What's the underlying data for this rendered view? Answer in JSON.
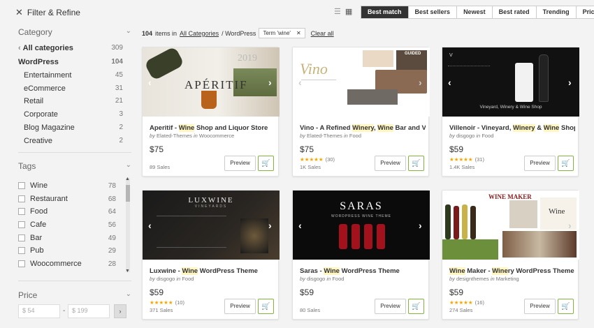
{
  "sidebar": {
    "filter_title": "Filter & Refine",
    "category_title": "Category",
    "all_categories": {
      "label": "All categories",
      "count": "309"
    },
    "categories": [
      {
        "label": "WordPress",
        "count": "104"
      },
      {
        "label": "Entertainment",
        "count": "45"
      },
      {
        "label": "eCommerce",
        "count": "31"
      },
      {
        "label": "Retail",
        "count": "21"
      },
      {
        "label": "Corporate",
        "count": "3"
      },
      {
        "label": "Blog Magazine",
        "count": "2"
      },
      {
        "label": "Creative",
        "count": "2"
      }
    ],
    "tags_title": "Tags",
    "tags": [
      {
        "label": "Wine",
        "count": "78"
      },
      {
        "label": "Restaurant",
        "count": "68"
      },
      {
        "label": "Food",
        "count": "64"
      },
      {
        "label": "Cafe",
        "count": "56"
      },
      {
        "label": "Bar",
        "count": "49"
      },
      {
        "label": "Pub",
        "count": "29"
      },
      {
        "label": "Woocommerce",
        "count": "28"
      }
    ],
    "price_title": "Price",
    "price_min_placeholder": "$ 54",
    "price_max_placeholder": "$ 199"
  },
  "toolbar": {
    "sort_options": [
      "Best match",
      "Best sellers",
      "Newest",
      "Best rated",
      "Trending",
      "Price"
    ],
    "active_sort": "Best match"
  },
  "results": {
    "count": "104",
    "items_in": "items in",
    "crumb_all": "All Categories",
    "crumb_sep": "/ WordPress",
    "term": "Term 'wine'",
    "clear": "Clear all"
  },
  "cards": [
    {
      "pre": "Aperitif - ",
      "hl1": "Wine",
      "mid": " Shop and Liquor Store",
      "hl2": "",
      "post": "",
      "by": "by",
      "author": "Elated-Themes",
      "in": "in",
      "cat": "Woocommerce",
      "price": "$75",
      "stars": "",
      "rating": "",
      "sales": "89 Sales",
      "thumb_text": "APÉRITIF",
      "thumb_sub": "2019"
    },
    {
      "pre": "Vino - A Refined ",
      "hl1": "Winery",
      "mid": ", ",
      "hl2": "Wine",
      "post": " Bar and Vin...",
      "by": "by",
      "author": "Elated-Themes",
      "in": "in",
      "cat": "Food",
      "price": "$75",
      "stars": "★★★★★",
      "rating": "(30)",
      "sales": "1K Sales",
      "thumb_text": "Vino",
      "thumb_sub": "GUIDED"
    },
    {
      "pre": "Villenoir - Vineyard, ",
      "hl1": "Winery",
      "mid": " & ",
      "hl2": "Wine",
      "post": " Shop",
      "by": "by",
      "author": "disgogo",
      "in": "in",
      "cat": "Food",
      "price": "$59",
      "stars": "★★★★★",
      "rating": "(31)",
      "sales": "1.4K Sales",
      "thumb_text": "VILLENOIR",
      "thumb_sub": "Vineyard, Winery & Wine Shop"
    },
    {
      "pre": "Luxwine - ",
      "hl1": "Wine",
      "mid": " WordPress Theme",
      "hl2": "",
      "post": "",
      "by": "by",
      "author": "disgogo",
      "in": "in",
      "cat": "Food",
      "price": "$59",
      "stars": "★★★★★",
      "rating": "(10)",
      "sales": "371 Sales",
      "thumb_text": "LUXWINE",
      "thumb_sub": "VINEYARDS"
    },
    {
      "pre": "Saras - ",
      "hl1": "Wine",
      "mid": " WordPress Theme",
      "hl2": "",
      "post": "",
      "by": "by",
      "author": "disgogo",
      "in": "in",
      "cat": "Food",
      "price": "$59",
      "stars": "",
      "rating": "",
      "sales": "80 Sales",
      "thumb_text": "SARAS",
      "thumb_sub": "WORDPRESS WINE THEME"
    },
    {
      "pre": "",
      "hl1": "Wine",
      "mid": " Maker - ",
      "hl2": "Wine",
      "post": "ry WordPress Theme",
      "by": "by",
      "author": "designthemes",
      "in": "in",
      "cat": "Marketing",
      "price": "$59",
      "stars": "★★★★★",
      "rating": "(16)",
      "sales": "274 Sales",
      "thumb_text": "WINE MAKER",
      "thumb_sub": "Wine"
    }
  ],
  "preview_label": "Preview",
  "colors": {
    "accent": "#82b440",
    "highlight": "#fff6c2",
    "star": "#f7a600",
    "active_sort": "#333333"
  }
}
